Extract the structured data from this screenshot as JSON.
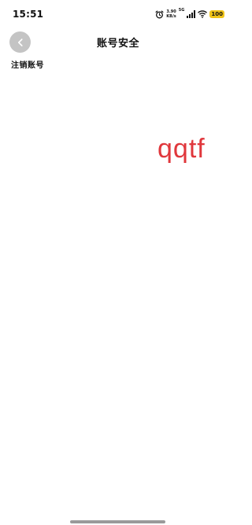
{
  "status_bar": {
    "time": "15:51",
    "net_speed_value": "3.90",
    "net_speed_unit": "KB/s",
    "network_gen": "5G",
    "battery": "100",
    "icons": [
      "alarm-icon",
      "signal-icon",
      "wifi-icon",
      "battery-icon"
    ]
  },
  "header": {
    "title": "账号安全",
    "back_icon": "chevron-left-icon"
  },
  "main": {
    "section_label": "注销账号",
    "floating_text": "qqtf",
    "floating_text_color": "#e0373c"
  },
  "colors": {
    "back_button_bg": "#c4c4c4",
    "battery_bg": "#f0c419"
  }
}
